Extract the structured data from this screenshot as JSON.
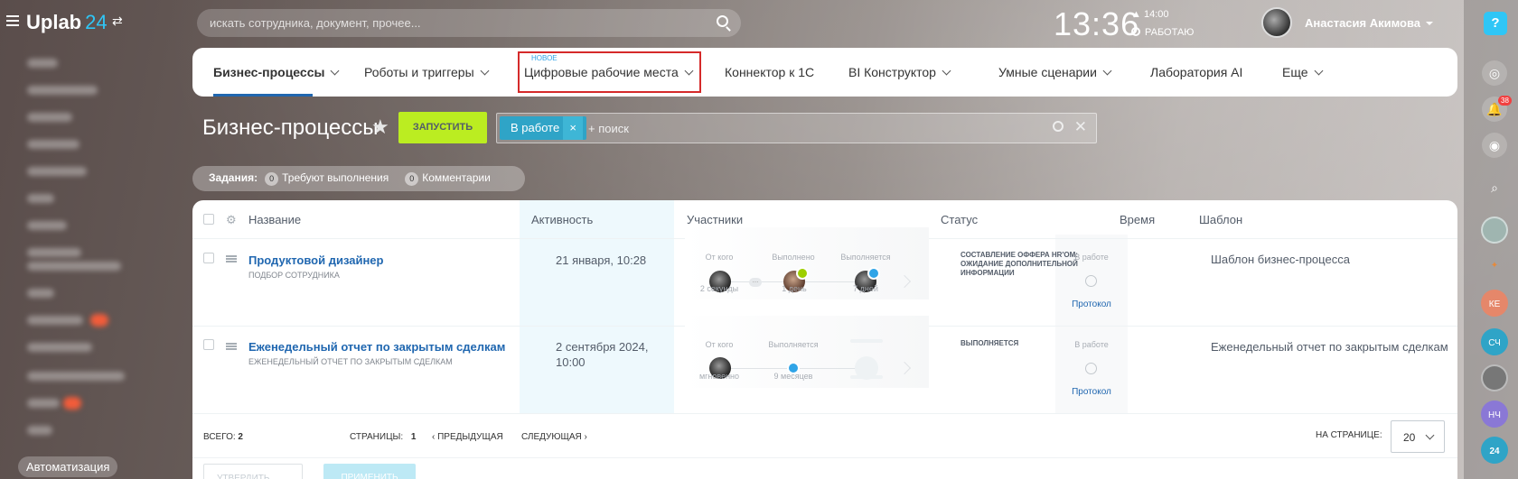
{
  "app": {
    "logo_name": "Uplab",
    "logo_num": "24"
  },
  "header": {
    "search_placeholder": "искать сотрудника, документ, прочее...",
    "clock": "13:36",
    "alarm": "14:00",
    "work_status": "РАБОТАЮ",
    "user_name": "Анастасия Акимова"
  },
  "leftmenu": {
    "automation_label": "Автоматизация"
  },
  "rightpanel": {
    "help": "?",
    "notify_count": "38",
    "users": [
      "КЕ",
      "СЧ",
      "НЧ"
    ]
  },
  "tabs": {
    "new_label": "НОВОЕ",
    "items": [
      "Бизнес-процессы",
      "Роботы и триггеры",
      "Цифровые рабочие места",
      "Коннектор к 1С",
      "BI Конструктор",
      "Умные сценарии",
      "Лаборатория AI",
      "Еще"
    ]
  },
  "page": {
    "title": "Бизнес-процессы",
    "run_label": "ЗАПУСТИТЬ"
  },
  "filter": {
    "tag": "В работе",
    "placeholder": "+ поиск"
  },
  "tasks": {
    "label": "Задания:",
    "pending_count": "0",
    "pending_label": "Требуют выполнения",
    "comments_count": "0",
    "comments_label": "Комментарии"
  },
  "table": {
    "headers": {
      "name": "Название",
      "activity": "Активность",
      "participants": "Участники",
      "status": "Статус",
      "time": "Время",
      "template": "Шаблон"
    },
    "rows": [
      {
        "name": "Продуктовой дизайнер",
        "sub": "ПОДБОР СОТРУДНИКА",
        "activity": "21 января, 10:28",
        "p_from": "От кого",
        "p_done": "Выполнено",
        "p_doing": "Выполняется",
        "p_from_time": "2 секунды",
        "p_done_time": "1 день",
        "p_doing_time": "7 дней",
        "status": "СОСТАВЛЕНИЕ ОФФЕРА HR'ОМ: ОЖИДАНИЕ ДОПОЛНИТЕЛЬНОЙ ИНФОРМАЦИИ",
        "time": "В работе",
        "protocol": "Протокол",
        "template": "Шаблон бизнес-процесса"
      },
      {
        "name": "Еженедельный отчет по закрытым сделкам",
        "sub": "ЕЖЕНЕДЕЛЬНЫЙ ОТЧЕТ ПО ЗАКРЫТЫМ СДЕЛКАМ",
        "activity_l1": "2 сентября 2024,",
        "activity_l2": "10:00",
        "p_from": "От кого",
        "p_doing": "Выполняется",
        "p_from_time": "мгновенно",
        "p_doing_time": "9 месяцев",
        "status": "ВЫПОЛНЯЕТСЯ",
        "time": "В работе",
        "protocol": "Протокол",
        "template": "Еженедельный отчет по закрытым сделкам"
      }
    ]
  },
  "footer": {
    "total_label": "ВСЕГО:",
    "total": "2",
    "pages_label": "СТРАНИЦЫ:",
    "page": "1",
    "prev": "ПРЕДЫДУЩАЯ",
    "next": "СЛЕДУЮЩАЯ",
    "per_page_label": "НА СТРАНИЦЕ:",
    "per_page": "20",
    "approve": "УТВЕРДИТЬ",
    "apply": "ПРИМЕНИТЬ"
  }
}
